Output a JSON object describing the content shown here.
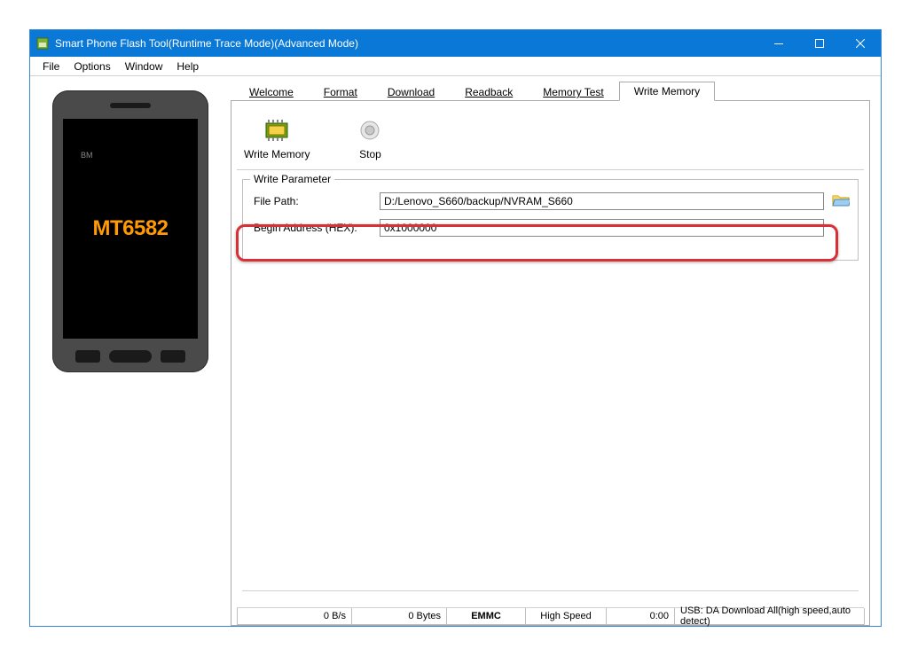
{
  "window": {
    "title": "Smart Phone Flash Tool(Runtime Trace Mode)(Advanced Mode)"
  },
  "menu": {
    "file": "File",
    "options": "Options",
    "window": "Window",
    "help": "Help"
  },
  "phone": {
    "bm": "BM",
    "chip": "MT6582"
  },
  "tabs": {
    "welcome": "Welcome",
    "format": "Format",
    "download": "Download",
    "readback": "Readback",
    "memory_test": "Memory Test",
    "write_memory": "Write Memory"
  },
  "toolbar": {
    "write_memory": "Write Memory",
    "stop": "Stop"
  },
  "params": {
    "legend": "Write Parameter",
    "file_path_label": "File Path:",
    "file_path_value": "D:/Lenovo_S660/backup/NVRAM_S660",
    "begin_addr_label": "Begin Address (HEX):",
    "begin_addr_value": "0x1000000"
  },
  "status": {
    "rate": "0 B/s",
    "bytes": "0 Bytes",
    "storage": "EMMC",
    "speed": "High Speed",
    "time": "0:00",
    "usb": "USB: DA Download All(high speed,auto detect)"
  }
}
